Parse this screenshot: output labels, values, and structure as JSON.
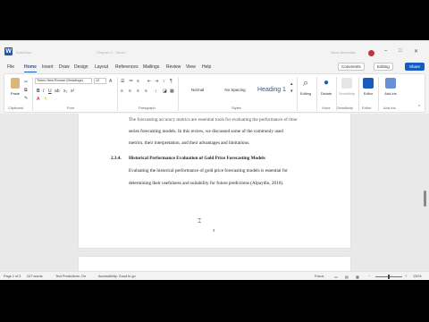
{
  "titlebar": {
    "app_icon": "W",
    "autosave": "AutoSave",
    "doc_title": "Chapter 2 - Saved",
    "search_placeholder": "Search",
    "user_name": "Nova Ahmadian"
  },
  "menu": {
    "items": [
      "File",
      "Home",
      "Insert",
      "Draw",
      "Design",
      "Layout",
      "References",
      "Mailings",
      "Review",
      "View",
      "Help"
    ],
    "active": "Home",
    "comments": "Comments",
    "editing": "Editing",
    "share": "Share"
  },
  "ribbon": {
    "paste": "Paste",
    "font_name": "Times New Roman (Headings)",
    "font_size": "12",
    "styles": [
      "Normal",
      "No Spacing",
      "Heading 1"
    ],
    "editing": "Editing",
    "dictate": "Dictate",
    "sensitivity": "Sensitivity",
    "editor": "Editor",
    "addins": "Add-ins",
    "groups": [
      "Clipboard",
      "Font",
      "Paragraph",
      "Styles",
      "Voice",
      "Sensitivity",
      "Editor",
      "Add-ins"
    ]
  },
  "document": {
    "line1": "The forecasting accuracy metrics are essential tools for evaluating the performance of time",
    "line2": "series forecasting models. In this review, we discussed some of the commonly used",
    "line3": "metrics, their interpretation, and their advantages and limitations.",
    "heading_num": "2.3.4.",
    "heading": "Historical Performance Evaluation of Gold Price Forecasting Models",
    "para1": "Evaluating the historical performance of gold price forecasting models is essential for",
    "para2": "determining their usefulness and suitability for future predictions (Alpaydin, 2010).",
    "page_number": "3"
  },
  "status": {
    "page": "Page 1 of 3",
    "words": "247 words",
    "language": "Text Predictions: On",
    "accessibility": "Accessibility: Good to go",
    "focus": "Focus",
    "zoom": "130%"
  }
}
